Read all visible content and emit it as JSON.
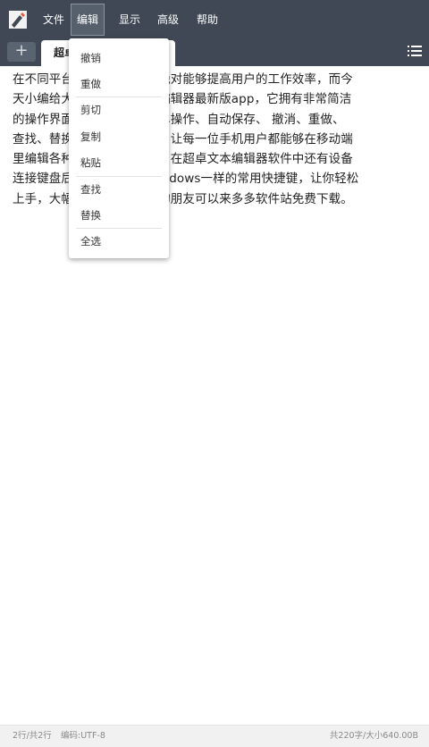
{
  "menubar": {
    "items": [
      "文件",
      "编辑",
      "显示",
      "高级",
      "帮助"
    ],
    "active": "编辑"
  },
  "tabs": {
    "add_label": "+",
    "active_tab": "超卓"
  },
  "editor": {
    "lines": [
      "在不同平台上使用的编辑器绝对能够提高用户的工作效率，而今",
      "天小编给大家带来超卓文本编辑器最新版app，它拥有非常简洁",
      "的操作界面，文件管理、菜单操作、自动保存、 撤消、重做、",
      "查找、替换等各种实用功能，让每一位手机用户都能够在移动端",
      "里编辑各种文本，除此之外，在超卓文本编辑器软件中还有设备",
      "连接键盘后，操作体验和Windows一样的常用快捷键，让你轻松",
      "上手，大幅提高效率，需要的朋友可以来多多软件站免费下载。"
    ]
  },
  "edit_menu": {
    "items": [
      "撤销",
      "重做",
      "剪切",
      "复制",
      "粘贴",
      "查找",
      "替换",
      "全选"
    ]
  },
  "status": {
    "position": "2行/共2行",
    "encoding": "编码:UTF-8",
    "count": "共220字/大小640.00B"
  },
  "colors": {
    "topbar": "#3f4854",
    "background": "#ffffff",
    "statusbar": "#f1f1f1"
  }
}
